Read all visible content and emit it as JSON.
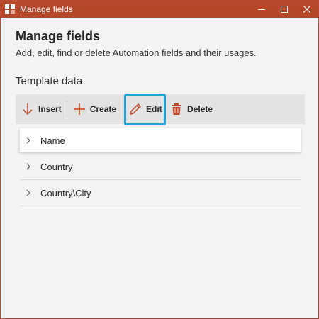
{
  "window": {
    "title": "Manage fields",
    "accent_color": "#b7472a"
  },
  "header": {
    "title": "Manage fields",
    "subtitle": "Add, edit, find or delete Automation fields and their usages."
  },
  "section": {
    "label": "Template data"
  },
  "toolbar": {
    "insert_label": "Insert",
    "create_label": "Create",
    "edit_label": "Edit",
    "delete_label": "Delete",
    "highlight_color": "#1ea3d6"
  },
  "fields": [
    {
      "label": "Name",
      "selected": true
    },
    {
      "label": "Country",
      "selected": false
    },
    {
      "label": "Country\\City",
      "selected": false
    }
  ],
  "icons": {
    "app": "app-logo-icon",
    "minimize": "minimize-icon",
    "maximize": "maximize-icon",
    "close": "close-icon",
    "insert": "arrow-down-icon",
    "create": "plus-icon",
    "edit": "pencil-icon",
    "delete": "trash-icon",
    "expand": "chevron-right-icon"
  }
}
